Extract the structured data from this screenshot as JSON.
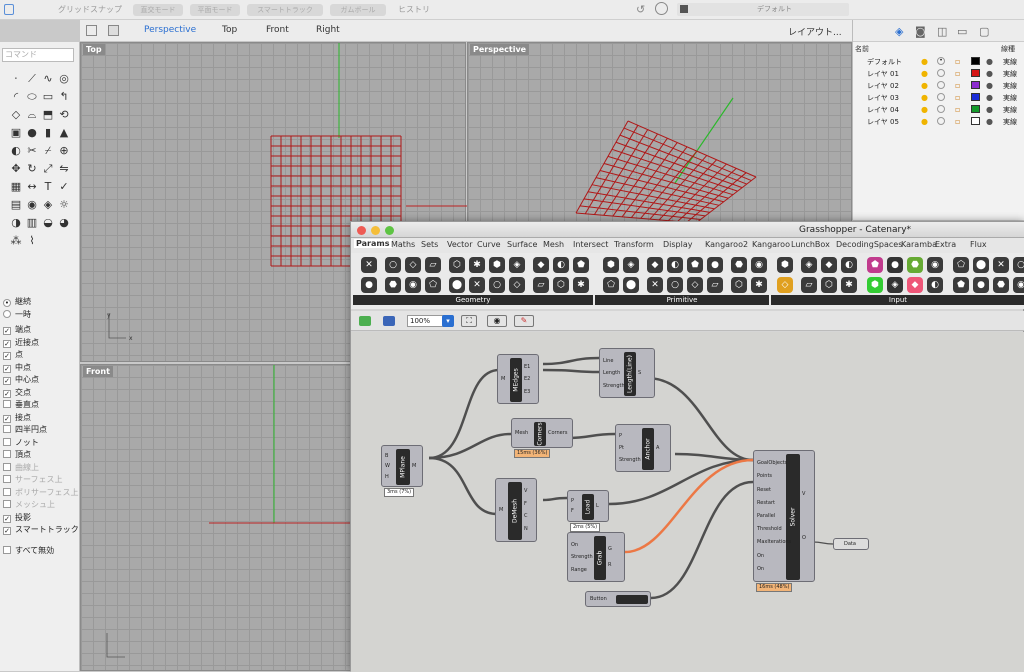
{
  "topbar": {
    "items": [
      "グリッドスナップ",
      "直交モード",
      "平面モード",
      "スマートトラック",
      "ガムボール",
      "ヒストリ"
    ],
    "layer_dropdown": "デフォルト"
  },
  "viewport_toolbar": {
    "tabs": [
      "Perspective",
      "Top",
      "Front",
      "Right"
    ],
    "active": "Perspective",
    "layout": "レイアウト..."
  },
  "command": {
    "placeholder": "コマンド"
  },
  "osnap": {
    "mode": [
      {
        "label": "継続",
        "selected": true
      },
      {
        "label": "一時",
        "selected": false
      }
    ],
    "items": [
      {
        "label": "端点",
        "checked": true,
        "enabled": true
      },
      {
        "label": "近接点",
        "checked": true,
        "enabled": true
      },
      {
        "label": "点",
        "checked": true,
        "enabled": true
      },
      {
        "label": "中点",
        "checked": true,
        "enabled": true
      },
      {
        "label": "中心点",
        "checked": true,
        "enabled": true
      },
      {
        "label": "交点",
        "checked": true,
        "enabled": true
      },
      {
        "label": "垂直点",
        "checked": false,
        "enabled": true
      },
      {
        "label": "接点",
        "checked": true,
        "enabled": true
      },
      {
        "label": "四半円点",
        "checked": false,
        "enabled": true
      },
      {
        "label": "ノット",
        "checked": false,
        "enabled": true
      },
      {
        "label": "頂点",
        "checked": false,
        "enabled": true
      },
      {
        "label": "曲線上",
        "checked": false,
        "enabled": false
      },
      {
        "label": "サーフェス上",
        "checked": false,
        "enabled": false
      },
      {
        "label": "ポリサーフェス上",
        "checked": false,
        "enabled": false
      },
      {
        "label": "メッシュ上",
        "checked": false,
        "enabled": false
      },
      {
        "label": "投影",
        "checked": true,
        "enabled": true
      },
      {
        "label": "スマートトラック",
        "checked": true,
        "enabled": true
      }
    ],
    "disable_all": "すべて無効"
  },
  "viewports": {
    "top": "Top",
    "perspective": "Perspective",
    "front": "Front"
  },
  "layers": {
    "col_name": "名前",
    "col_linetype": "線種",
    "rows": [
      {
        "name": "デフォルト",
        "color": "#000000",
        "linetype": "実線",
        "current": true
      },
      {
        "name": "レイヤ 01",
        "color": "#d41414",
        "linetype": "実線",
        "current": false
      },
      {
        "name": "レイヤ 02",
        "color": "#8d2bd0",
        "linetype": "実線",
        "current": false
      },
      {
        "name": "レイヤ 03",
        "color": "#1a2cd8",
        "linetype": "実線",
        "current": false
      },
      {
        "name": "レイヤ 04",
        "color": "#149a2b",
        "linetype": "実線",
        "current": false
      },
      {
        "name": "レイヤ 05",
        "color": "#ffffff",
        "linetype": "実線",
        "current": false
      }
    ]
  },
  "grasshopper": {
    "title": "Grasshopper - Catenary*",
    "tabs": [
      "Params",
      "Maths",
      "Sets",
      "Vector",
      "Curve",
      "Surface",
      "Mesh",
      "Intersect",
      "Transform",
      "Display",
      "Kangaroo2",
      "Kangaroo",
      "LunchBox",
      "DecodingSpaces",
      "Karamba",
      "Extra",
      "Flux"
    ],
    "active_tab": "Params",
    "groups": [
      "Geometry",
      "Primitive",
      "Input"
    ],
    "zoom": "100%",
    "components": {
      "mplane": {
        "name": "MPlane",
        "inputs": [
          "B",
          "W",
          "H"
        ],
        "outputs": [
          "M"
        ],
        "time": "3ms (7%)"
      },
      "medges": {
        "name": "MEdges",
        "inputs": [
          "M"
        ],
        "outputs": [
          "E1",
          "E2",
          "E3"
        ]
      },
      "length": {
        "name": "Length(Line)",
        "inputs": [
          "Line",
          "Length",
          "Strength"
        ],
        "outputs": [
          "S"
        ]
      },
      "corners": {
        "name": "Corners",
        "inputs": [
          "Mesh"
        ],
        "outputs": [
          "Corners"
        ],
        "time": "15ms (36%)"
      },
      "anchor": {
        "name": "Anchor",
        "inputs": [
          "P",
          "Pt",
          "Strength"
        ],
        "outputs": [
          "A"
        ]
      },
      "demesh": {
        "name": "DeMesh",
        "inputs": [
          "M"
        ],
        "outputs": [
          "V",
          "F",
          "C",
          "N"
        ]
      },
      "load": {
        "name": "Load",
        "inputs": [
          "P",
          "F"
        ],
        "outputs": [
          "L"
        ],
        "time": "2ms (5%)"
      },
      "grab": {
        "name": "Grab",
        "inputs": [
          "On",
          "Strength",
          "Range"
        ],
        "outputs": [
          "G",
          "R"
        ]
      },
      "solver": {
        "name": "Solver",
        "inputs": [
          "GoalObjects",
          "Points",
          "Reset",
          "Restart",
          "Parallel",
          "Threshold",
          "MaxIterations",
          "On",
          "On"
        ],
        "outputs": [
          "V",
          "O"
        ],
        "time": "16ms (48%)"
      },
      "button": {
        "name": "Button"
      },
      "data": {
        "name": "Data"
      }
    }
  }
}
